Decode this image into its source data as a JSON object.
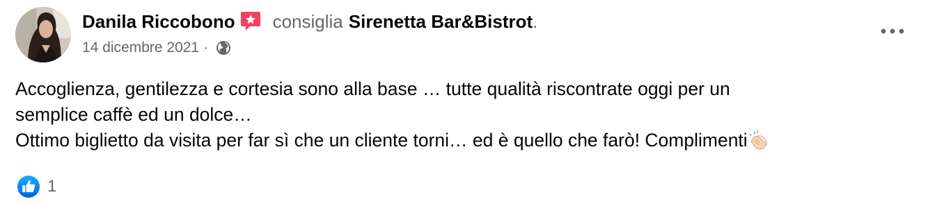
{
  "post": {
    "author": "Danila Riccobono",
    "verb": "consiglia",
    "page_name": "Sirenetta Bar&Bistrot",
    "period": ".",
    "date": "14 dicembre 2021",
    "meta_separator": "·",
    "privacy_icon": "globe-icon",
    "badge_icon": "recommend-star-icon",
    "more_icon": "more-options-icon",
    "body_lines": [
      "Accoglienza, gentilezza e cortesia sono alla base … tutte qualità riscontrate oggi per un",
      "semplice caffè ed un dolce…",
      "Ottimo biglietto da visita per far sì che un cliente torni… ed è quello che farò! Complimenti"
    ],
    "body_emoji": "clapping-hands-icon",
    "reactions": {
      "icon": "like-icon",
      "count": "1"
    }
  },
  "colors": {
    "primary_text": "#050505",
    "secondary_text": "#65676b",
    "badge_red": "#f3425f",
    "like_blue": "#1877f2"
  }
}
